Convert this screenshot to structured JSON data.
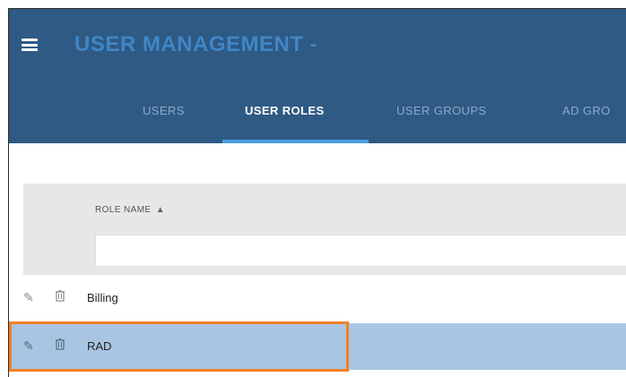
{
  "app": {
    "title": "USER MANAGEMENT -"
  },
  "tabs": [
    {
      "label": "USERS",
      "active": false
    },
    {
      "label": "USER ROLES",
      "active": true
    },
    {
      "label": "USER GROUPS",
      "active": false
    },
    {
      "label": "AD GRO",
      "active": false
    }
  ],
  "grid": {
    "column_header": "ROLE NAME",
    "sort_icon": "sort-icon",
    "filter_value": "",
    "filter_placeholder": ""
  },
  "rows": [
    {
      "name": "Billing",
      "selected": false
    },
    {
      "name": "RAD",
      "selected": true
    }
  ],
  "icons": {
    "menu": "menu-icon",
    "edit": "pencil-icon",
    "delete": "trash-icon"
  },
  "colors": {
    "header_bg": "#2e5a84",
    "title": "#3f86c6",
    "tab_active_underline": "#4ea0e0",
    "selected_row": "#a8c6e2",
    "highlight_border": "#f28123"
  }
}
